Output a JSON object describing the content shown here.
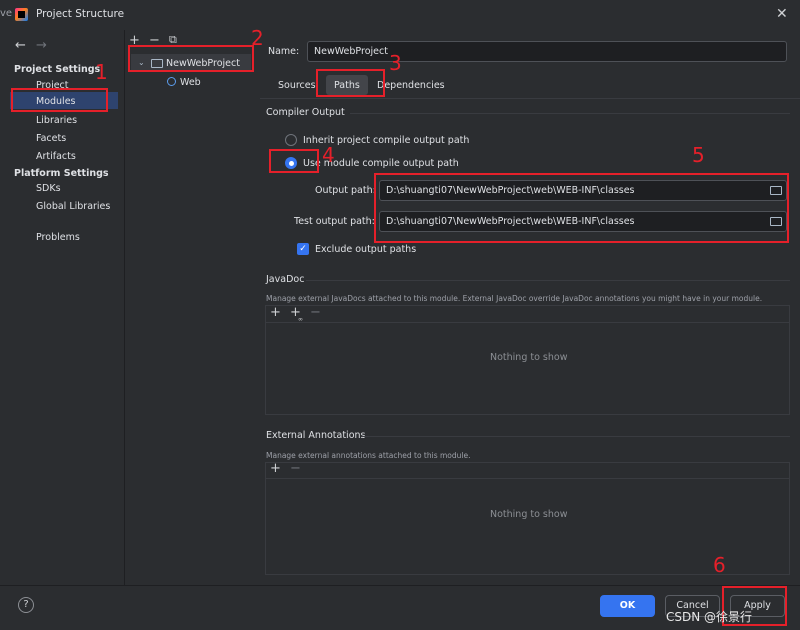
{
  "window": {
    "title": "Project Structure",
    "left_edge_fragment": "ve",
    "close_glyph": "✕"
  },
  "left_nav": {
    "back": "←",
    "forward": "→",
    "project_settings_header": "Project Settings",
    "project_items": [
      "Project",
      "Modules",
      "Libraries",
      "Facets",
      "Artifacts"
    ],
    "platform_settings_header": "Platform Settings",
    "platform_items": [
      "SDKs",
      "Global Libraries"
    ],
    "problems": "Problems",
    "selected": "Modules"
  },
  "tree": {
    "toolbar": {
      "add": "+",
      "remove": "−",
      "copy": "⧉"
    },
    "root_label": "NewWebProject",
    "child_label": "Web"
  },
  "module": {
    "name_label": "Name:",
    "name_value": "NewWebProject",
    "tabs": [
      "Sources",
      "Paths",
      "Dependencies"
    ],
    "active_tab": "Paths"
  },
  "compiler_output": {
    "title": "Compiler Output",
    "radio_inherit": "Inherit project compile output path",
    "radio_use_module": "Use module compile output path",
    "output_path_label": "Output path:",
    "output_path_value": "D:\\shuangti07\\NewWebProject\\web\\WEB-INF\\classes",
    "test_output_path_label": "Test output path:",
    "test_output_path_value": "D:\\shuangti07\\NewWebProject\\web\\WEB-INF\\classes",
    "exclude_label": "Exclude output paths",
    "exclude_checked": true
  },
  "javadoc": {
    "title": "JavaDoc",
    "description": "Manage external JavaDocs attached to this module. External JavaDoc override JavaDoc annotations you might have in your module.",
    "empty_text": "Nothing to show",
    "tool_add": "+",
    "tool_add_url": "+",
    "tool_remove": "−"
  },
  "external_annotations": {
    "title": "External Annotations",
    "description": "Manage external annotations attached to this module.",
    "empty_text": "Nothing to show",
    "tool_add": "+",
    "tool_remove": "−"
  },
  "bottom": {
    "help": "?",
    "ok": "OK",
    "cancel": "Cancel",
    "apply": "Apply"
  },
  "annotations": [
    "1",
    "2",
    "3",
    "4",
    "5",
    "6"
  ],
  "watermark": "CSDN @徐景行",
  "colors": {
    "background": "#2b2d30",
    "accent": "#3574f0",
    "selection": "#2e436e",
    "annotation_red": "#e5202a"
  }
}
